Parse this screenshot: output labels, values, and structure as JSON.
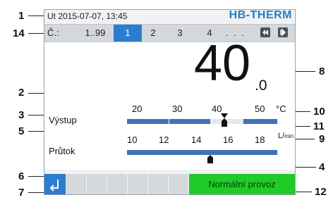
{
  "status_bar": {
    "datetime": "Ut 2015-07-07, 13:45",
    "brand": "HB-THERM"
  },
  "tabs": {
    "prefix": "Č.:",
    "range": "1..99",
    "items": [
      "1",
      "2",
      "3",
      "4"
    ],
    "active": "1",
    "ellipsis": ". . ."
  },
  "temperature": {
    "whole": "40",
    "decimal": ".0"
  },
  "outlet_row": {
    "label": "Výstup",
    "ticks": [
      "20",
      "30",
      "40",
      "50"
    ],
    "unit": "°C"
  },
  "flow_row": {
    "label": "Průtok",
    "ticks": [
      "10",
      "12",
      "14",
      "16",
      "18"
    ],
    "unit_l": "L",
    "unit_min": "min"
  },
  "bottom_bar": {
    "mode": "Normální provoz"
  },
  "callouts": [
    "1",
    "14",
    "2",
    "3",
    "5",
    "6",
    "7",
    "8",
    "10",
    "11",
    "9",
    "4",
    "12"
  ],
  "colors": {
    "accent": "#2c7dd0",
    "brand": "#1f7fc8",
    "mode_ok": "#1fcc27",
    "bar": "#3f73b8"
  },
  "icons": [
    "prev-page-icon",
    "next-page-icon",
    "back-icon",
    "setpoint-marker-icon",
    "actual-value-marker-icon",
    "flow-marker-icon"
  ]
}
